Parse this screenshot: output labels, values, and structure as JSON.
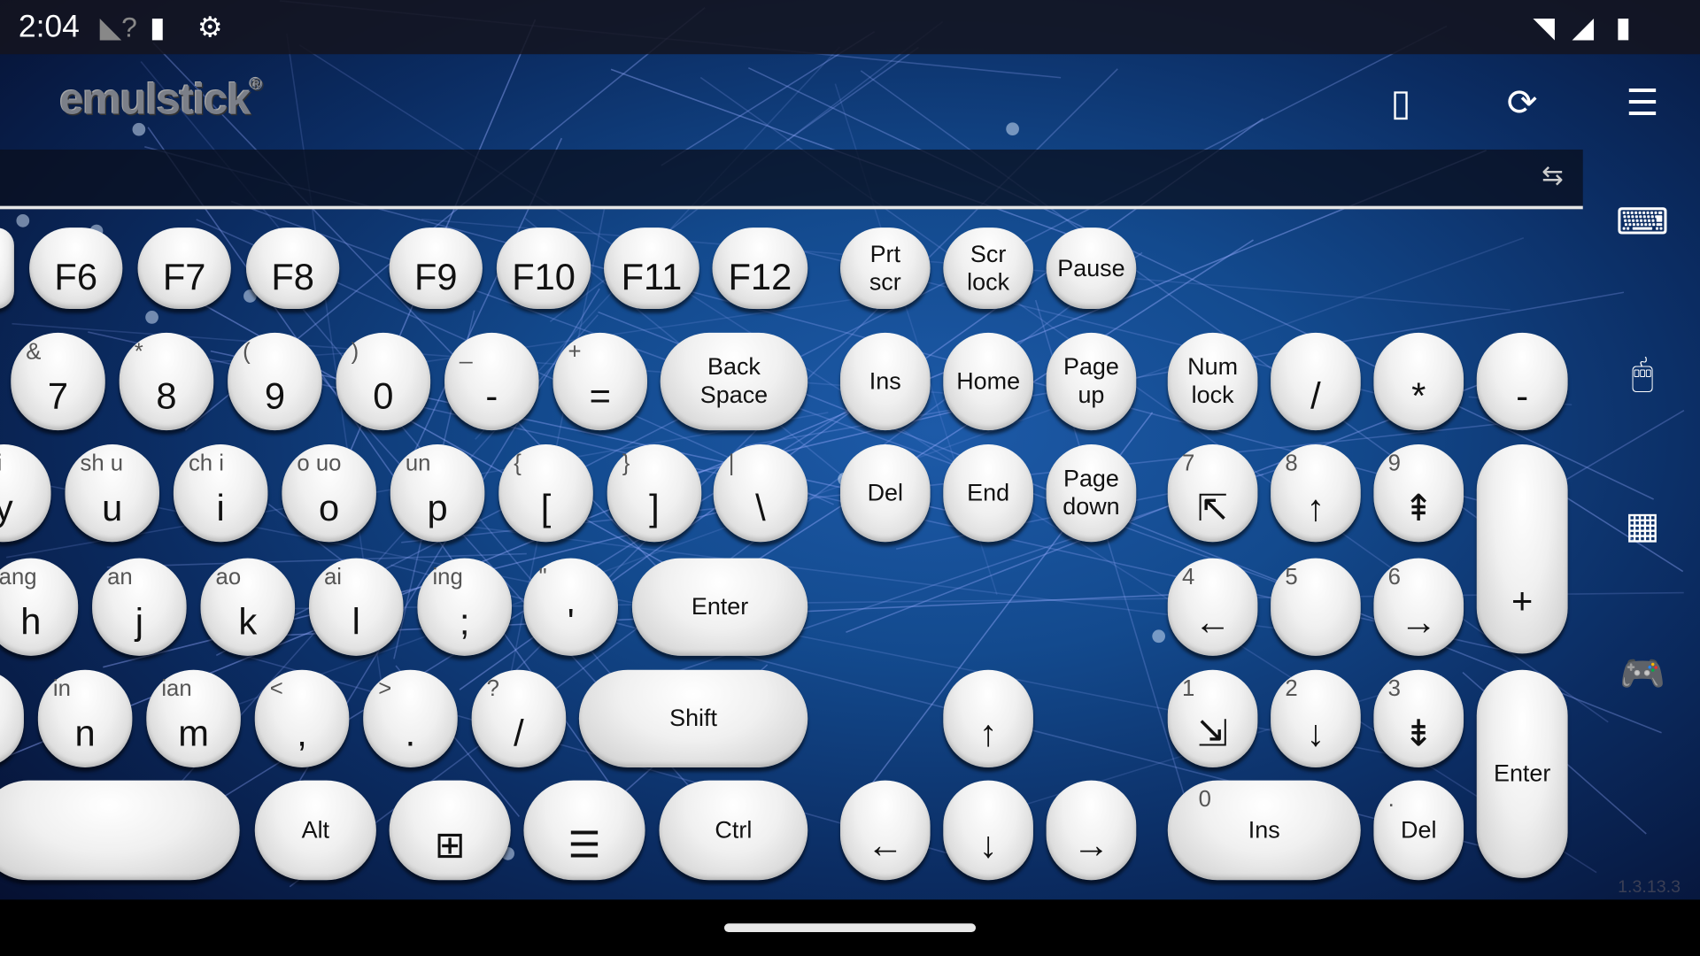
{
  "status_bar": {
    "time": "2:04",
    "icons": [
      "wifi-unknown-icon",
      "sd-card-icon",
      "android-debug-icon",
      "wifi-icon",
      "signal-icon",
      "battery-icon"
    ]
  },
  "header": {
    "logo": "emulstick",
    "registered": "®",
    "icons": [
      "phone-icon",
      "sync-icon",
      "list-icon"
    ]
  },
  "text_bar": {
    "value": "",
    "swap_icon": "swap-arrows-icon"
  },
  "side_icons": [
    "keyboard-icon",
    "mouse-icon",
    "widgets-icon",
    "gamepad-icon"
  ],
  "version": "1.3.13.3",
  "keys": [
    {
      "main": ""
    },
    {
      "main": "F6"
    },
    {
      "main": "F7"
    },
    {
      "main": "F8"
    },
    {
      "main": "F9"
    },
    {
      "main": "F10"
    },
    {
      "main": "F11"
    },
    {
      "main": "F12"
    },
    {
      "main": "Prt\nscr"
    },
    {
      "main": "Scr\nlock"
    },
    {
      "main": "Pause"
    },
    {
      "sub": "&",
      "main": "7"
    },
    {
      "sub": "*",
      "main": "8"
    },
    {
      "sub": "(",
      "main": "9"
    },
    {
      "sub": ")",
      "main": "0"
    },
    {
      "sub": "_",
      "main": "-"
    },
    {
      "sub": "+",
      "main": "="
    },
    {
      "main": "Back\nSpace"
    },
    {
      "main": "Ins"
    },
    {
      "main": "Home"
    },
    {
      "main": "Page\nup"
    },
    {
      "main": "Num\nlock"
    },
    {
      "main": "/"
    },
    {
      "main": "*"
    },
    {
      "main": "-"
    },
    {
      "sub": "uai",
      "main": "y"
    },
    {
      "sub": "sh u",
      "main": "u"
    },
    {
      "sub": "ch i",
      "main": "i"
    },
    {
      "sub": "o uo",
      "main": "o"
    },
    {
      "sub": "un",
      "main": "p"
    },
    {
      "sub": "{",
      "main": "["
    },
    {
      "sub": "}",
      "main": "]"
    },
    {
      "sub": "|",
      "main": "\\"
    },
    {
      "main": "Del"
    },
    {
      "main": "End"
    },
    {
      "main": "Page\ndown"
    },
    {
      "sub": "7",
      "main": "⇱"
    },
    {
      "sub": "8",
      "main": "↑"
    },
    {
      "sub": "9",
      "main": "⇞"
    },
    {
      "main": "+"
    },
    {
      "sub": "ang",
      "main": "h"
    },
    {
      "sub": "an",
      "main": "j"
    },
    {
      "sub": "ao",
      "main": "k"
    },
    {
      "sub": "ai",
      "main": "l"
    },
    {
      "sub": "ing",
      "main": ";"
    },
    {
      "sub": "\"",
      "main": "'"
    },
    {
      "main": "Enter"
    },
    {
      "sub": "4",
      "main": "←"
    },
    {
      "sub": "5",
      "main": ""
    },
    {
      "sub": "6",
      "main": "→"
    },
    {
      "main": ""
    },
    {
      "sub": "in",
      "main": "n"
    },
    {
      "sub": "ian",
      "main": "m"
    },
    {
      "sub": "<",
      "main": ","
    },
    {
      "sub": ">",
      "main": "."
    },
    {
      "sub": "?",
      "main": "/"
    },
    {
      "main": "Shift"
    },
    {
      "main": "↑"
    },
    {
      "sub": "1",
      "main": "⇲"
    },
    {
      "sub": "2",
      "main": "↓"
    },
    {
      "sub": "3",
      "main": "⇟"
    },
    {
      "main": "Enter"
    },
    {
      "main": ""
    },
    {
      "main": "Alt"
    },
    {
      "main": "⊞"
    },
    {
      "main": "☰"
    },
    {
      "main": "Ctrl"
    },
    {
      "main": "←"
    },
    {
      "main": "↓"
    },
    {
      "main": "→"
    },
    {
      "sub": "0",
      "main": "Ins"
    },
    {
      "sub": ".",
      "main": "Del"
    }
  ]
}
